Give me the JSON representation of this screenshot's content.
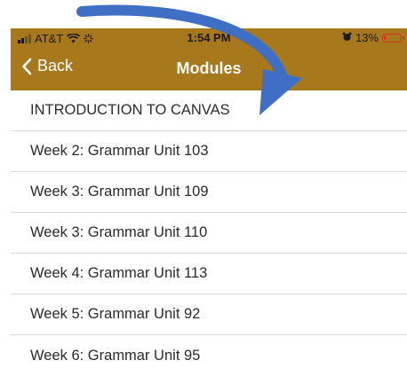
{
  "status_bar": {
    "carrier": "AT&T",
    "time": "1:54 PM",
    "battery_percent": "13%",
    "battery_level": 0.13,
    "icons": [
      "signal-icon",
      "wifi-icon",
      "activity-icon",
      "alarm-icon",
      "battery-icon"
    ]
  },
  "nav": {
    "back_label": "Back",
    "title": "Modules"
  },
  "modules": [
    "INTRODUCTION TO CANVAS",
    "Week 2: Grammar Unit 103",
    "Week 3: Grammar Unit 109",
    "Week 3: Grammar Unit 110",
    "Week 4: Grammar Unit 113",
    "Week 5: Grammar Unit 92",
    "Week 6: Grammar Unit 95"
  ],
  "colors": {
    "header": "#a8781c",
    "arrow": "#3f6fc4",
    "battery_low": "#d93025",
    "divider": "#dcdcdc"
  }
}
